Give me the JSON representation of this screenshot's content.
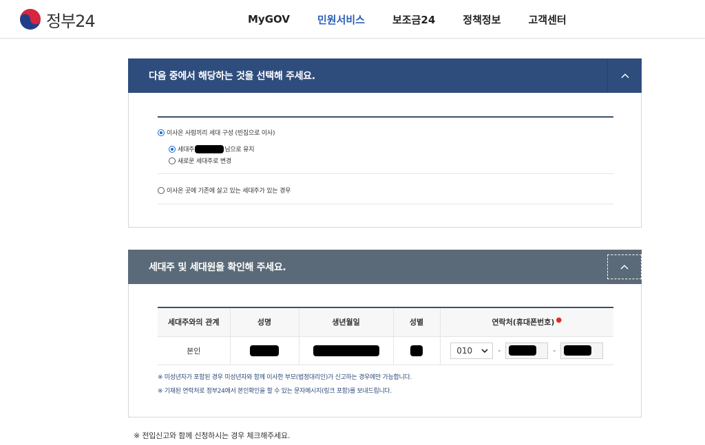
{
  "header": {
    "logo_text": "정부24",
    "nav": [
      "MyGOV",
      "민원서비스",
      "보조금24",
      "정책정보",
      "고객센터"
    ],
    "active_nav": "민원서비스"
  },
  "section1": {
    "title": "다음 중에서 해당하는 것을 선택해 주세요.",
    "option1": {
      "label": "이사온 사람끼리 세대 구성 (빈집으로 이사)",
      "selected": true,
      "sub1_prefix": "세대주",
      "sub1_suffix": "님으로 유지",
      "sub2": "새로운 세대주로 변경"
    },
    "option2": {
      "label": "이사온 곳에 기존에 살고 있는 세대주가 있는 경우",
      "selected": false
    }
  },
  "section2": {
    "title": "세대주 및 세대원을 확인해 주세요.",
    "columns": [
      "세대주와의 관계",
      "성명",
      "생년월일",
      "성별",
      "연락처(휴대폰번호)"
    ],
    "row": {
      "relation": "본인",
      "phone_prefix": "010",
      "dash": "-"
    },
    "notes": [
      "※ 미성년자가 포함된 경우 미성년자와 함께 이사한 부모(법정대리인)가 신고하는 경우에만 가능합니다.",
      "※ 기재된 연락처로 정부24에서 본인확인을 할 수 있는 문자메시지(링크 포함)를 보내드립니다."
    ]
  },
  "bottom_note": "※ 전입신고와 함께 신청하시는 경우 체크해주세요.",
  "colors": {
    "section1_header": "#2f4d7c",
    "section2_header": "#5b6a78",
    "active_nav": "#2a5fb9",
    "note_text": "#2d4a78"
  }
}
